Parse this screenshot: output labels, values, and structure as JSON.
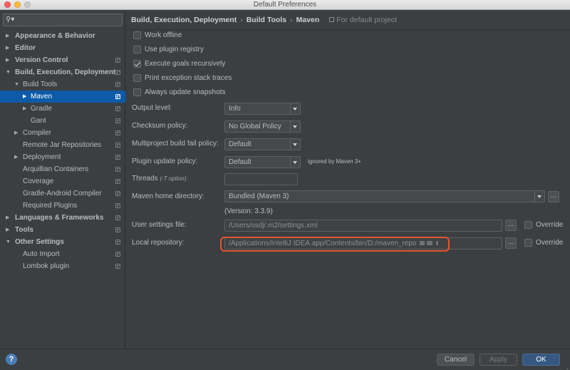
{
  "window": {
    "title": "Default Preferences"
  },
  "search": {
    "placeholder": ""
  },
  "sidebar": {
    "items": [
      {
        "label": "Appearance & Behavior",
        "level": 0,
        "arrow": "▶",
        "bold": true
      },
      {
        "label": "Editor",
        "level": 0,
        "arrow": "▶",
        "bold": true
      },
      {
        "label": "Version Control",
        "level": 0,
        "arrow": "▶",
        "bold": true
      },
      {
        "label": "Build, Execution, Deployment",
        "level": 0,
        "arrow": "▼",
        "bold": true
      },
      {
        "label": "Build Tools",
        "level": 1,
        "arrow": "▼"
      },
      {
        "label": "Maven",
        "level": 2,
        "arrow": "▶",
        "selected": true
      },
      {
        "label": "Gradle",
        "level": 2,
        "arrow": "▶"
      },
      {
        "label": "Gant",
        "level": 2,
        "arrow": ""
      },
      {
        "label": "Compiler",
        "level": 1,
        "arrow": "▶"
      },
      {
        "label": "Remote Jar Repositories",
        "level": 1,
        "arrow": ""
      },
      {
        "label": "Deployment",
        "level": 1,
        "arrow": "▶"
      },
      {
        "label": "Arquillian Containers",
        "level": 1,
        "arrow": ""
      },
      {
        "label": "Coverage",
        "level": 1,
        "arrow": ""
      },
      {
        "label": "Gradle-Android Compiler",
        "level": 1,
        "arrow": ""
      },
      {
        "label": "Required Plugins",
        "level": 1,
        "arrow": ""
      },
      {
        "label": "Languages & Frameworks",
        "level": 0,
        "arrow": "▶",
        "bold": true
      },
      {
        "label": "Tools",
        "level": 0,
        "arrow": "▶",
        "bold": true
      },
      {
        "label": "Other Settings",
        "level": 0,
        "arrow": "▼",
        "bold": true
      },
      {
        "label": "Auto Import",
        "level": 1,
        "arrow": ""
      },
      {
        "label": "Lombok plugin",
        "level": 1,
        "arrow": ""
      }
    ]
  },
  "breadcrumb": {
    "parts": [
      "Build, Execution, Deployment",
      "Build Tools",
      "Maven"
    ],
    "separator": "›",
    "scope": "For default project"
  },
  "checkboxes": [
    {
      "label": "Work offline",
      "checked": false
    },
    {
      "label": "Use plugin registry",
      "checked": false
    },
    {
      "label": "Execute goals recursively",
      "checked": true
    },
    {
      "label": "Print exception stack traces",
      "checked": false
    },
    {
      "label": "Always update snapshots",
      "checked": false
    }
  ],
  "fields": {
    "output_level": {
      "label": "Output level:",
      "value": "Info"
    },
    "checksum_policy": {
      "label": "Checksum policy:",
      "value": "No Global Policy"
    },
    "multiproject_policy": {
      "label": "Multiproject build fail policy:",
      "value": "Default"
    },
    "plugin_update_policy": {
      "label": "Plugin update policy:",
      "value": "Default",
      "note": "ignored by Maven 3+"
    },
    "threads": {
      "label": "Threads",
      "hint": "(-T option):",
      "value": ""
    },
    "maven_home": {
      "label": "Maven home directory:",
      "value": "Bundled (Maven 3)",
      "browse": "...",
      "version": "(Version: 3.3.9)"
    },
    "user_settings": {
      "label": "User settings file:",
      "value": "/Users/ssdj/.m2/settings.xml",
      "browse": "...",
      "override": "Override"
    },
    "local_repo": {
      "label": "Local repository:",
      "value": "/Applications/IntelliJ IDEA.app/Contents/bin/D:/maven_repo",
      "browse": "...",
      "override": "Override"
    }
  },
  "buttons": {
    "help": "?",
    "cancel": "Cancel",
    "apply": "Apply",
    "ok": "OK"
  },
  "colors": {
    "selection": "#0d5ba8",
    "highlight": "#e2562c",
    "primary": "#365880"
  }
}
